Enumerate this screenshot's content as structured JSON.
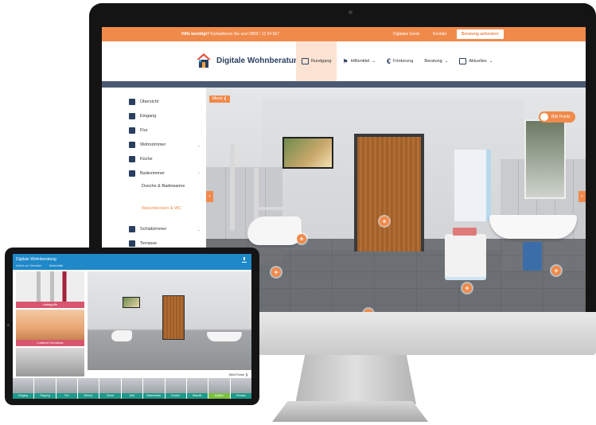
{
  "topbar": {
    "notice_bold": "Hilfe benötigt?",
    "notice_text": "Kontaktieren Sie uns! 0800 / 12 34 567",
    "links": [
      "Digitales Gerät",
      "Kontakt"
    ],
    "cta_label": "Beratung anfordern"
  },
  "header": {
    "logo_text": "Digitale Wohnberatung",
    "nav": [
      {
        "label": "Rundgang",
        "active": true
      },
      {
        "label": "Hilfsmittel",
        "dropdown": true
      },
      {
        "label": "Förderung"
      },
      {
        "label": "Beratung",
        "dropdown": true
      },
      {
        "label": "Aktuelles",
        "dropdown": true
      }
    ]
  },
  "sidebar": {
    "items": [
      {
        "label": "Übersicht"
      },
      {
        "label": "Eingang"
      },
      {
        "label": "Flur"
      },
      {
        "label": "Wohnzimmer"
      },
      {
        "label": "Küche"
      },
      {
        "label": "Badezimmer"
      },
      {
        "label": "Schlafzimmer"
      },
      {
        "label": "Terrasse"
      }
    ],
    "sub_items": [
      "Dusche & Badewanne",
      "Waschbecken & WC"
    ]
  },
  "room": {
    "back_label": "Menü ❮",
    "toggle_label": "Bild Points"
  },
  "tablet": {
    "title": "Digitale Wohnberatung",
    "sub1": "Zurück zur Übersicht",
    "sub2": "Bedienhilfe",
    "cards": [
      "Haltegriffe",
      "Lowlevel Schränke"
    ],
    "more_label": "Bild-Points  ❯",
    "thumbs": [
      "Eingang",
      "Ringang",
      "Flur",
      "Wohnzi.",
      "Küche",
      "Bad",
      "Badezimmer",
      "Dusche",
      "Waschb.",
      "Schlafzi.",
      "Terrasse"
    ]
  },
  "colors": {
    "accent": "#f08a4b",
    "navy": "#2a3f5f",
    "tablet_header": "#1e88c9",
    "thumb_label": "#1f9a8a",
    "thumb_active": "#7ac143"
  }
}
